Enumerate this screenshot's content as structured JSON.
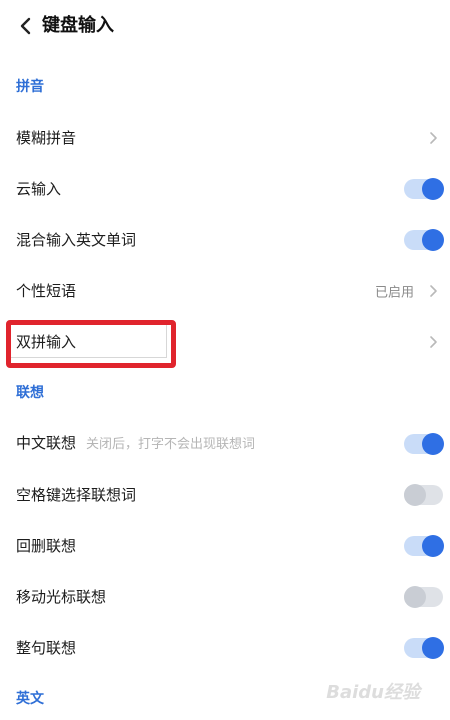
{
  "header": {
    "title": "键盘输入"
  },
  "sections": {
    "pinyin": "拼音",
    "lianxiang": "联想",
    "english": "英文"
  },
  "rows": {
    "fuzzy_pinyin": {
      "label": "模糊拼音"
    },
    "cloud_input": {
      "label": "云输入",
      "enabled": true
    },
    "mixed_english": {
      "label": "混合输入英文单词",
      "enabled": true
    },
    "personal_phrases": {
      "label": "个性短语",
      "value": "已启用"
    },
    "shuangpin": {
      "label": "双拼输入"
    },
    "chinese_assoc": {
      "label": "中文联想",
      "hint": "关闭后，打字不会出现联想词",
      "enabled": true
    },
    "space_select": {
      "label": "空格键选择联想词",
      "enabled": false
    },
    "delete_assoc": {
      "label": "回删联想",
      "enabled": true
    },
    "cursor_assoc": {
      "label": "移动光标联想",
      "enabled": false
    },
    "sentence_assoc": {
      "label": "整句联想",
      "enabled": true
    }
  },
  "icons": {
    "back": "chevron-left-icon",
    "chevron": "chevron-right-icon"
  },
  "colors": {
    "accent": "#2f6fe4",
    "section": "#2f6fd6",
    "highlight": "#e0242d"
  },
  "watermark": "Baidu经验"
}
